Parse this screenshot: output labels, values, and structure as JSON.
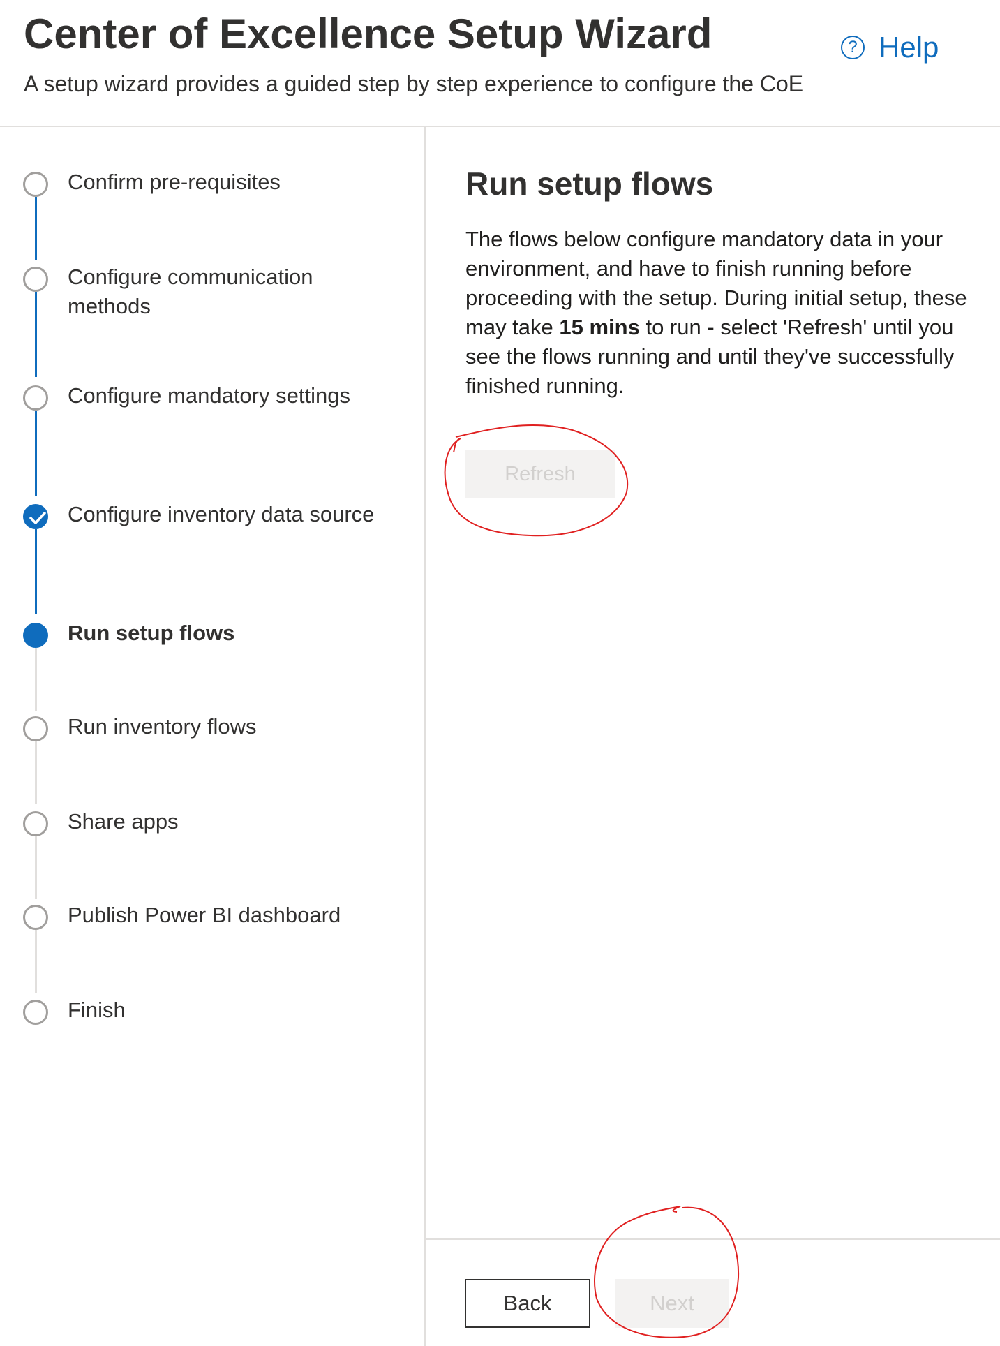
{
  "header": {
    "title": "Center of Excellence Setup Wizard",
    "subtitle": "A setup wizard provides a guided step by step experience to configure the CoE",
    "help_label": "Help",
    "help_icon": "question-circle-icon",
    "help_icon_glyph": "?"
  },
  "steps": [
    {
      "label": "Confirm pre-requisites",
      "state": "pending"
    },
    {
      "label": "Configure communication methods",
      "state": "pending"
    },
    {
      "label": "Configure mandatory settings",
      "state": "pending"
    },
    {
      "label": "Configure inventory data source",
      "state": "done"
    },
    {
      "label": "Run setup flows",
      "state": "current"
    },
    {
      "label": "Run inventory flows",
      "state": "pending"
    },
    {
      "label": "Share apps",
      "state": "pending"
    },
    {
      "label": "Publish Power BI dashboard",
      "state": "pending"
    },
    {
      "label": "Finish",
      "state": "pending"
    }
  ],
  "main": {
    "title": "Run setup flows",
    "body_before": "The flows below configure mandatory data in your environment, and have to finish running before proceeding with the setup. During initial setup, these may take ",
    "body_bold": "15 mins",
    "body_after": " to run - select 'Refresh' until you see the flows running and until they've successfully finished running.",
    "refresh_label": "Refresh",
    "refresh_disabled": true
  },
  "footer": {
    "back_label": "Back",
    "next_label": "Next",
    "next_disabled": true
  },
  "colors": {
    "accent": "#0f6cbd",
    "annotation": "#e02020",
    "disabled_bg": "#f3f2f1",
    "disabled_text": "#d2d0ce"
  }
}
